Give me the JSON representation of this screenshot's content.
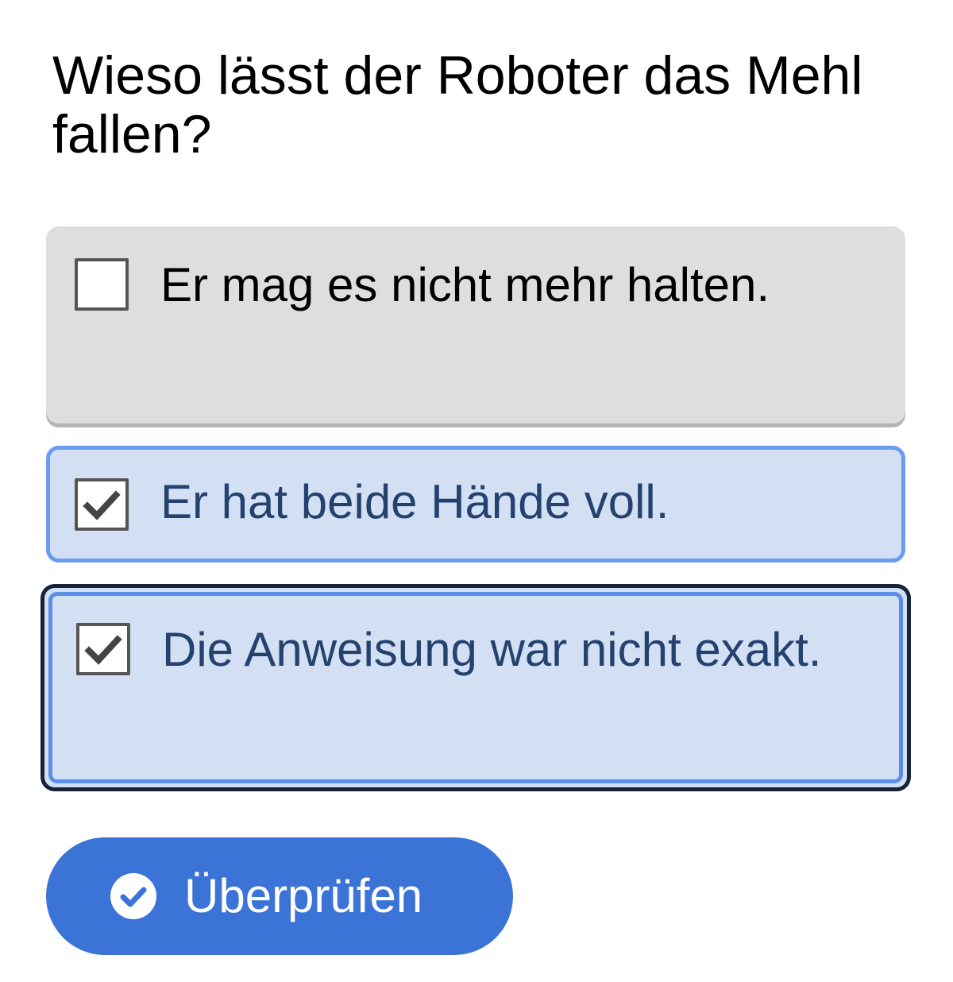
{
  "question": {
    "text": "Wieso lässt der Roboter das Mehl fallen?"
  },
  "options": [
    {
      "label": "Er mag es nicht mehr halten.",
      "checked": false
    },
    {
      "label": "Er hat beide Hände voll.",
      "checked": true
    },
    {
      "label": "Die Anweisung war nicht exakt.",
      "checked": true,
      "focused": true
    }
  ],
  "check_button": {
    "label": "Überprüfen",
    "icon": "check-circle-icon"
  },
  "colors": {
    "unchecked_bg": "#dedede",
    "checked_bg": "#d3e0f3",
    "checked_border": "#6c9cf0",
    "checked_text": "#24426f",
    "focus_outline": "#18233a",
    "button_bg": "#3b73d6"
  }
}
